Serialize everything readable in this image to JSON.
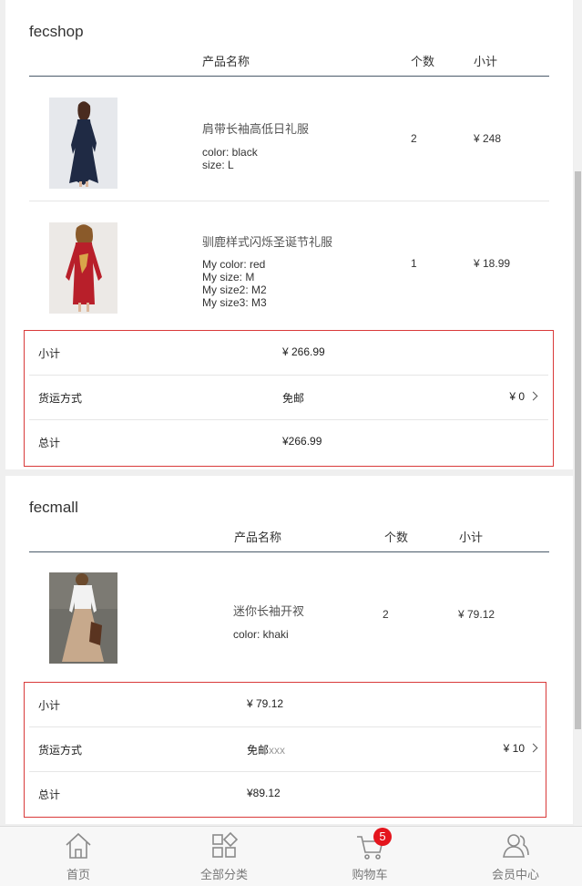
{
  "stores": [
    {
      "name": "fecshop",
      "headers": {
        "product": "产品名称",
        "qty": "个数",
        "subtotal": "小计"
      },
      "items": [
        {
          "name": "肩带长袖高低日礼服",
          "attrs": [
            "color: black",
            "size: L"
          ],
          "qty": "2",
          "subtotal": "¥ 248",
          "image": "navy-dress-photo"
        },
        {
          "name": "驯鹿样式闪烁圣诞节礼服",
          "attrs": [
            "My color: red",
            "My size: M",
            "My size2: M2",
            "My size3: M3"
          ],
          "qty": "1",
          "subtotal": "¥ 18.99",
          "image": "red-reindeer-dress-photo"
        }
      ],
      "summary": {
        "subtotal_label": "小计",
        "subtotal_value": "¥ 266.99",
        "shipping_label": "货运方式",
        "shipping_method": "免邮",
        "shipping_method_extra": "",
        "shipping_cost": "¥ 0",
        "total_label": "总计",
        "total_value": "¥266.99"
      }
    },
    {
      "name": "fecmall",
      "headers": {
        "product": "产品名称",
        "qty": "个数",
        "subtotal": "小计"
      },
      "items": [
        {
          "name": "迷你长袖开衩",
          "attrs": [
            "color: khaki"
          ],
          "qty": "2",
          "subtotal": "¥ 79.12",
          "image": "khaki-maxi-skirt-photo"
        }
      ],
      "summary": {
        "subtotal_label": "小计",
        "subtotal_value": "¥ 79.12",
        "shipping_label": "货运方式",
        "shipping_method": "免邮",
        "shipping_method_extra": "xxx",
        "shipping_cost": "¥ 10",
        "total_label": "总计",
        "total_value": "¥89.12"
      }
    }
  ],
  "nav": [
    {
      "label": "首页",
      "icon": "home-icon"
    },
    {
      "label": "全部分类",
      "icon": "categories-icon"
    },
    {
      "label": "购物车",
      "icon": "cart-icon",
      "badge": "5"
    },
    {
      "label": "会员中心",
      "icon": "member-icon"
    }
  ],
  "colors": {
    "accent_border": "#d93a3a",
    "badge": "#e4151d",
    "header_line": "#4a5a6a"
  }
}
